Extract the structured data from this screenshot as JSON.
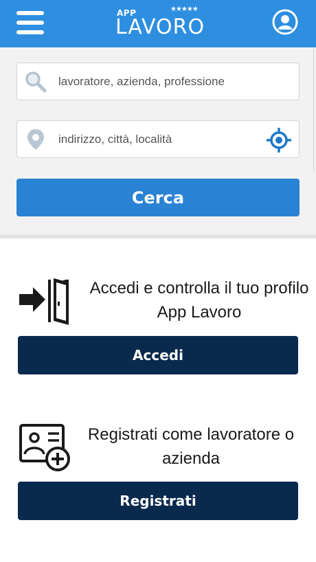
{
  "header": {
    "logo_small": "APP",
    "logo_main": "LAVORO",
    "logo_stars": "★★★★★",
    "menu_icon": "hamburger-menu-icon",
    "account_icon": "user-account-icon",
    "bar_color": "#2e8ee0"
  },
  "search": {
    "keywords_placeholder": "lavoratore, azienda, professione",
    "location_placeholder": "indirizzo, città, località",
    "search_label": "Cerca",
    "keywords_icon": "search-icon",
    "location_icon": "map-pin-icon",
    "locate_icon": "gps-target-icon",
    "button_color": "#2a82d4"
  },
  "login": {
    "text": "Accedi e controlla il tuo profilo App Lavoro",
    "button_label": "Accedi",
    "icon": "login-door-icon"
  },
  "register": {
    "text": "Registrati come lavoratore o azienda",
    "button_label": "Registrati",
    "icon": "add-id-card-icon",
    "button_color": "#0a2a4d"
  }
}
